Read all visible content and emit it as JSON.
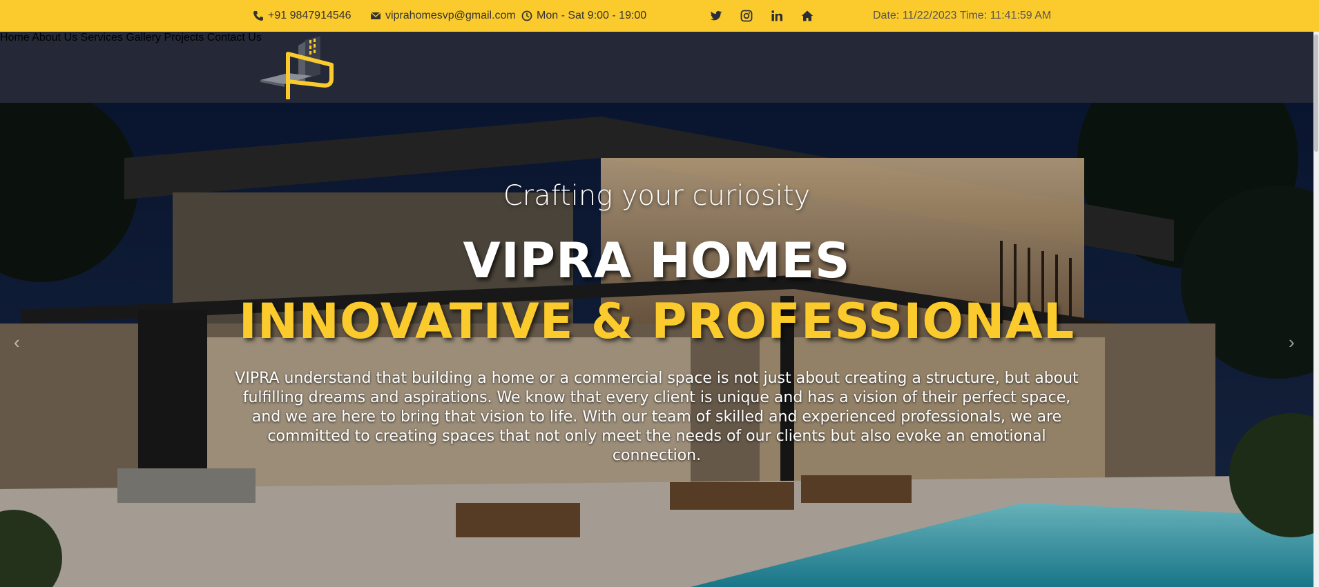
{
  "topbar": {
    "phone": "+91 9847914546",
    "email": "viprahomesvp@gmail.com",
    "hours": "Mon - Sat 9:00 - 19:00",
    "datetime": "Date: 11/22/2023 Time: 11:41:59 AM",
    "social": [
      "twitter-icon",
      "instagram-icon",
      "linkedin-icon",
      "home-icon"
    ]
  },
  "nav": {
    "items": [
      "Home",
      "About Us",
      "Services",
      "Gallery",
      "Projects",
      "Contact Us"
    ]
  },
  "hero": {
    "subtitle": "Crafting your curiosity",
    "title": "VIPRA HOMES",
    "tagline": "INNOVATIVE & PROFESSIONAL",
    "description": "VIPRA understand that building a home or a commercial space is not just about creating a structure, but about fulfilling dreams and aspirations. We know that every client is unique and has a vision of their perfect space, and we are here to bring that vision to life. With our team of skilled and experienced professionals, we are committed to creating spaces that not only meet the needs of our clients but also evoke an emotional connection.",
    "prev_arrow": "‹",
    "next_arrow": "›"
  },
  "colors": {
    "accent": "#fbcb2d",
    "nav_bg": "#242837"
  }
}
